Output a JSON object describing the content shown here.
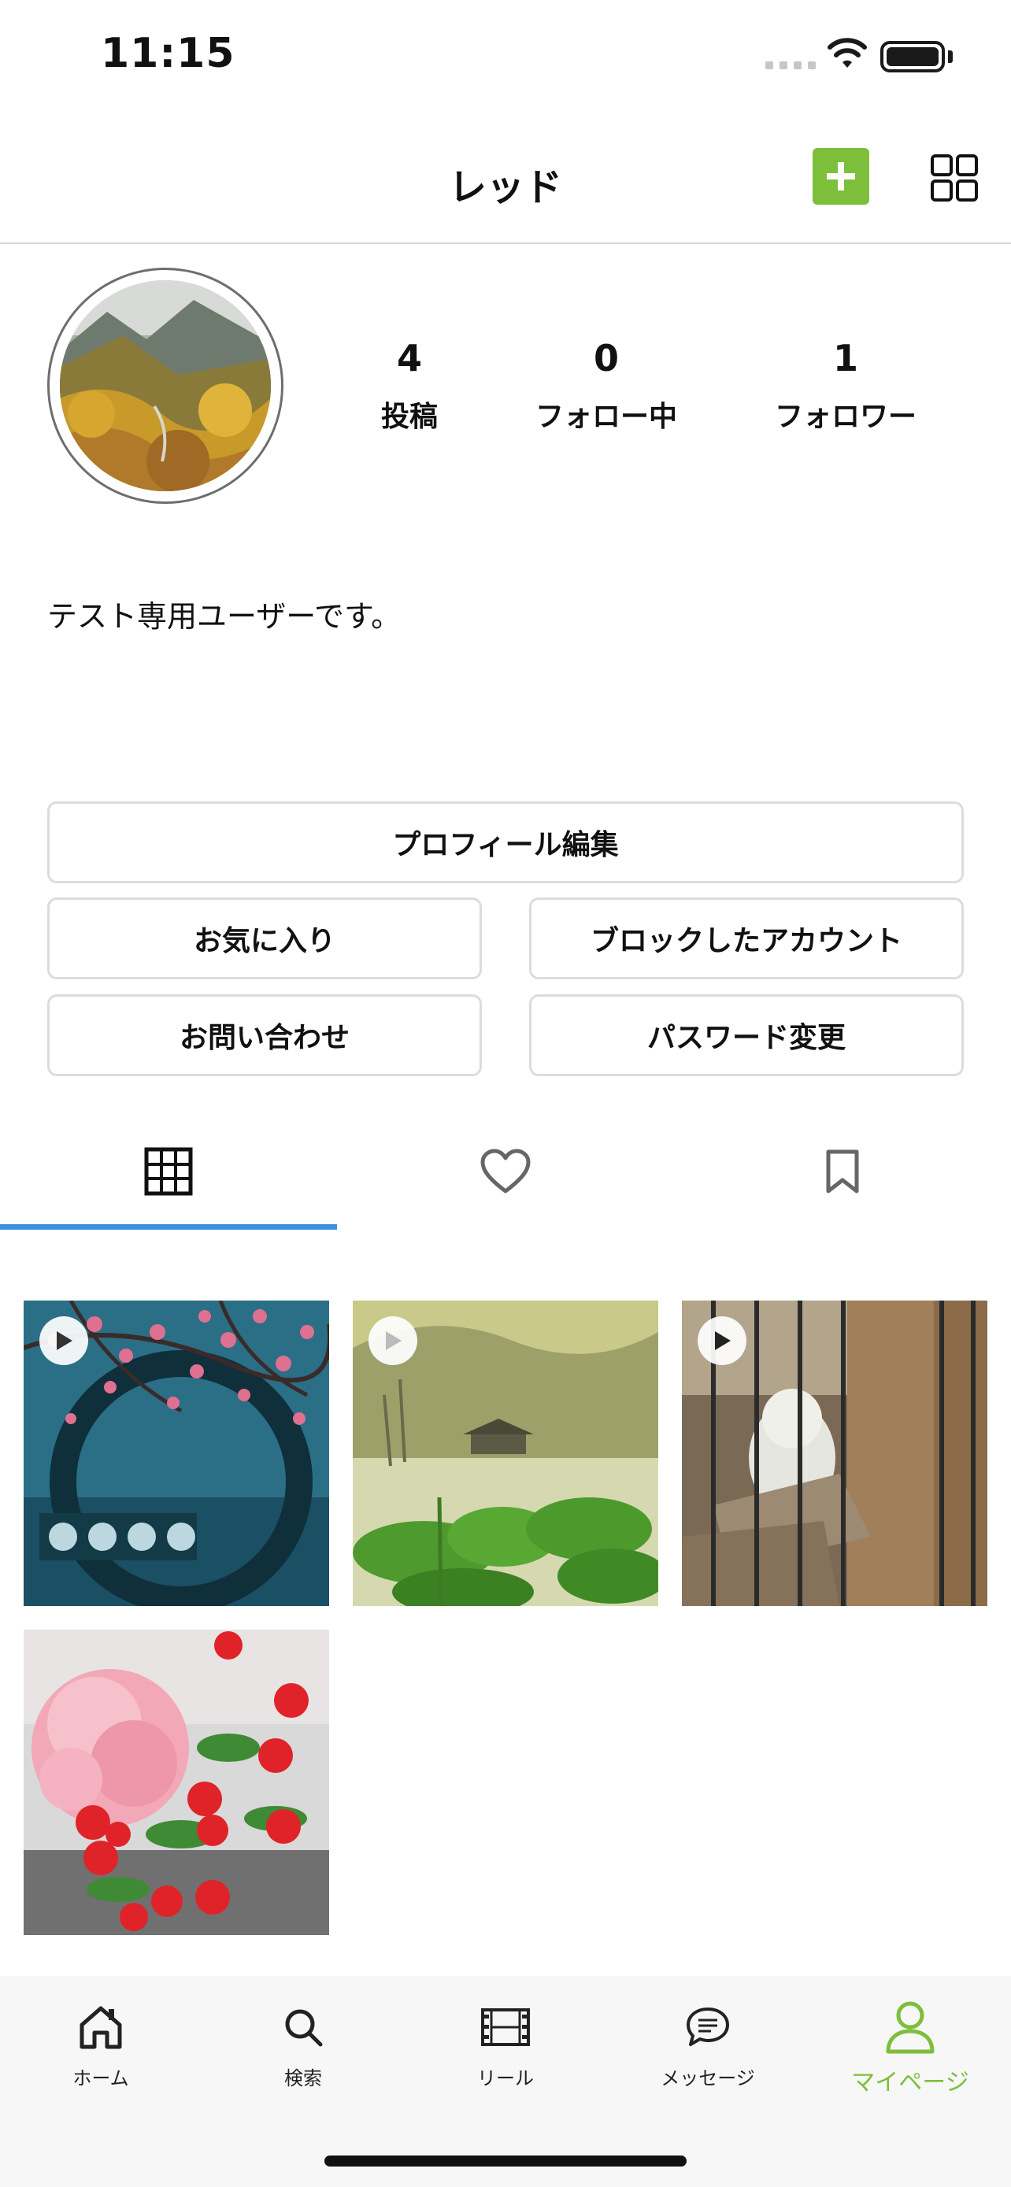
{
  "status_bar": {
    "time": "11:15"
  },
  "header": {
    "title": "レッド"
  },
  "profile": {
    "stats": [
      {
        "value": "4",
        "label": "投稿"
      },
      {
        "value": "0",
        "label": "フォロー中"
      },
      {
        "value": "1",
        "label": "フォロワー"
      }
    ],
    "bio": "テスト専用ユーザーです。"
  },
  "actions": {
    "edit_profile": "プロフィール編集",
    "favorites": "お気に入り",
    "blocked_accounts": "ブロックしたアカウント",
    "contact": "お問い合わせ",
    "change_password": "パスワード変更"
  },
  "profile_tabs": [
    "grid",
    "liked",
    "saved"
  ],
  "posts": [
    {
      "type": "video",
      "subject": "plum blossoms and round window"
    },
    {
      "type": "video",
      "subject": "misty lake with lotus leaves"
    },
    {
      "type": "video",
      "subject": "snowy owl behind bars"
    },
    {
      "type": "image",
      "subject": "pink carnation with red berries"
    }
  ],
  "tab_bar": {
    "items": [
      {
        "label": "ホーム",
        "icon": "home-icon"
      },
      {
        "label": "検索",
        "icon": "search-icon"
      },
      {
        "label": "リール",
        "icon": "film-icon"
      },
      {
        "label": "メッセージ",
        "icon": "chat-icon"
      },
      {
        "label": "マイページ",
        "icon": "person-icon"
      }
    ],
    "active_index": 4
  },
  "colors": {
    "accent": "#7dbf3a",
    "tab_indicator": "#3e91e0",
    "border": "#dcdcdc"
  }
}
